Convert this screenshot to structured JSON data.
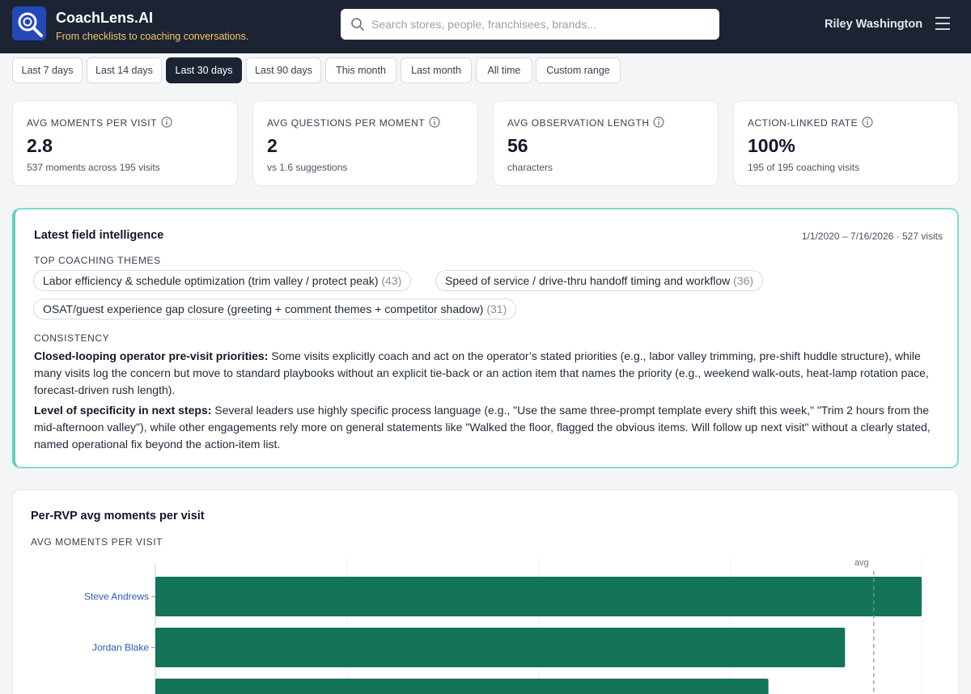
{
  "header": {
    "brand_name": "CoachLens.AI",
    "tagline": "From checklists to coaching conversations.",
    "search_placeholder": "Search stores, people, franchisees, brands...",
    "user_name": "Riley Washington"
  },
  "date_ranges": [
    {
      "label": "Last 7 days",
      "active": false
    },
    {
      "label": "Last 14 days",
      "active": false
    },
    {
      "label": "Last 30 days",
      "active": true
    },
    {
      "label": "Last 90 days",
      "active": false
    },
    {
      "label": "This month",
      "active": false
    },
    {
      "label": "Last month",
      "active": false
    },
    {
      "label": "All time",
      "active": false
    },
    {
      "label": "Custom range",
      "active": false
    }
  ],
  "kpis": [
    {
      "label": "AVG MOMENTS PER VISIT",
      "value": "2.8",
      "sub": "537 moments across 195 visits"
    },
    {
      "label": "AVG QUESTIONS PER MOMENT",
      "value": "2",
      "sub": "vs 1.6 suggestions"
    },
    {
      "label": "AVG OBSERVATION LENGTH",
      "value": "56",
      "sub": "characters"
    },
    {
      "label": "ACTION-LINKED RATE",
      "value": "100%",
      "sub": "195 of 195 coaching visits"
    }
  ],
  "intel": {
    "title": "Latest field intelligence",
    "meta": "1/1/2020 – 7/16/2026 · 527 visits",
    "themes_label": "TOP COACHING THEMES",
    "themes": [
      {
        "text": "Labor efficiency & schedule optimization (trim valley / protect peak)",
        "count": "(43)"
      },
      {
        "text": "Speed of service / drive-thru handoff timing and workflow",
        "count": "(36)"
      },
      {
        "text": "OSAT/guest experience gap closure (greeting + comment themes + competitor shadow)",
        "count": "(31)"
      }
    ],
    "consistency_label": "CONSISTENCY",
    "paragraphs": [
      {
        "lead": "Closed-looping operator pre-visit priorities:",
        "body": " Some visits explicitly coach and act on the operator’s stated priorities (e.g., labor valley trimming, pre-shift huddle structure), while many visits log the concern but move to standard playbooks without an explicit tie-back or an action item that names the priority (e.g., weekend walk-outs, heat-lamp rotation pace, forecast-driven rush length)."
      },
      {
        "lead": "Level of specificity in next steps:",
        "body": " Several leaders use highly specific process language (e.g., \"Use the same three-prompt template every shift this week,\" \"Trim 2 hours from the mid-afternoon valley\"), while other engagements rely more on general statements like \"Walked the floor, flagged the obvious items. Will follow up next visit\" without a clearly stated, named operational fix beyond the action-item list."
      }
    ]
  },
  "chart": {
    "title": "Per-RVP avg moments per visit",
    "subtitle": "AVG MOMENTS PER VISIT"
  },
  "chart_data": {
    "type": "bar",
    "orientation": "horizontal",
    "title": "Per-RVP avg moments per visit",
    "ylabel": "AVG MOMENTS PER VISIT",
    "categories": [
      "Steve Andrews",
      "Jordan Blake",
      ""
    ],
    "values": [
      4.0,
      3.6,
      3.2
    ],
    "xlim": [
      0,
      4.0
    ],
    "reference_line": {
      "label": "avg",
      "value": 3.75
    },
    "bar_color": "#13745a",
    "grid": true
  },
  "colors": {
    "header_bg": "#1c2434",
    "tagline": "#f3c56b",
    "accent_border": "#5fd1c0",
    "bar": "#13745a",
    "link": "#2a5db0"
  }
}
